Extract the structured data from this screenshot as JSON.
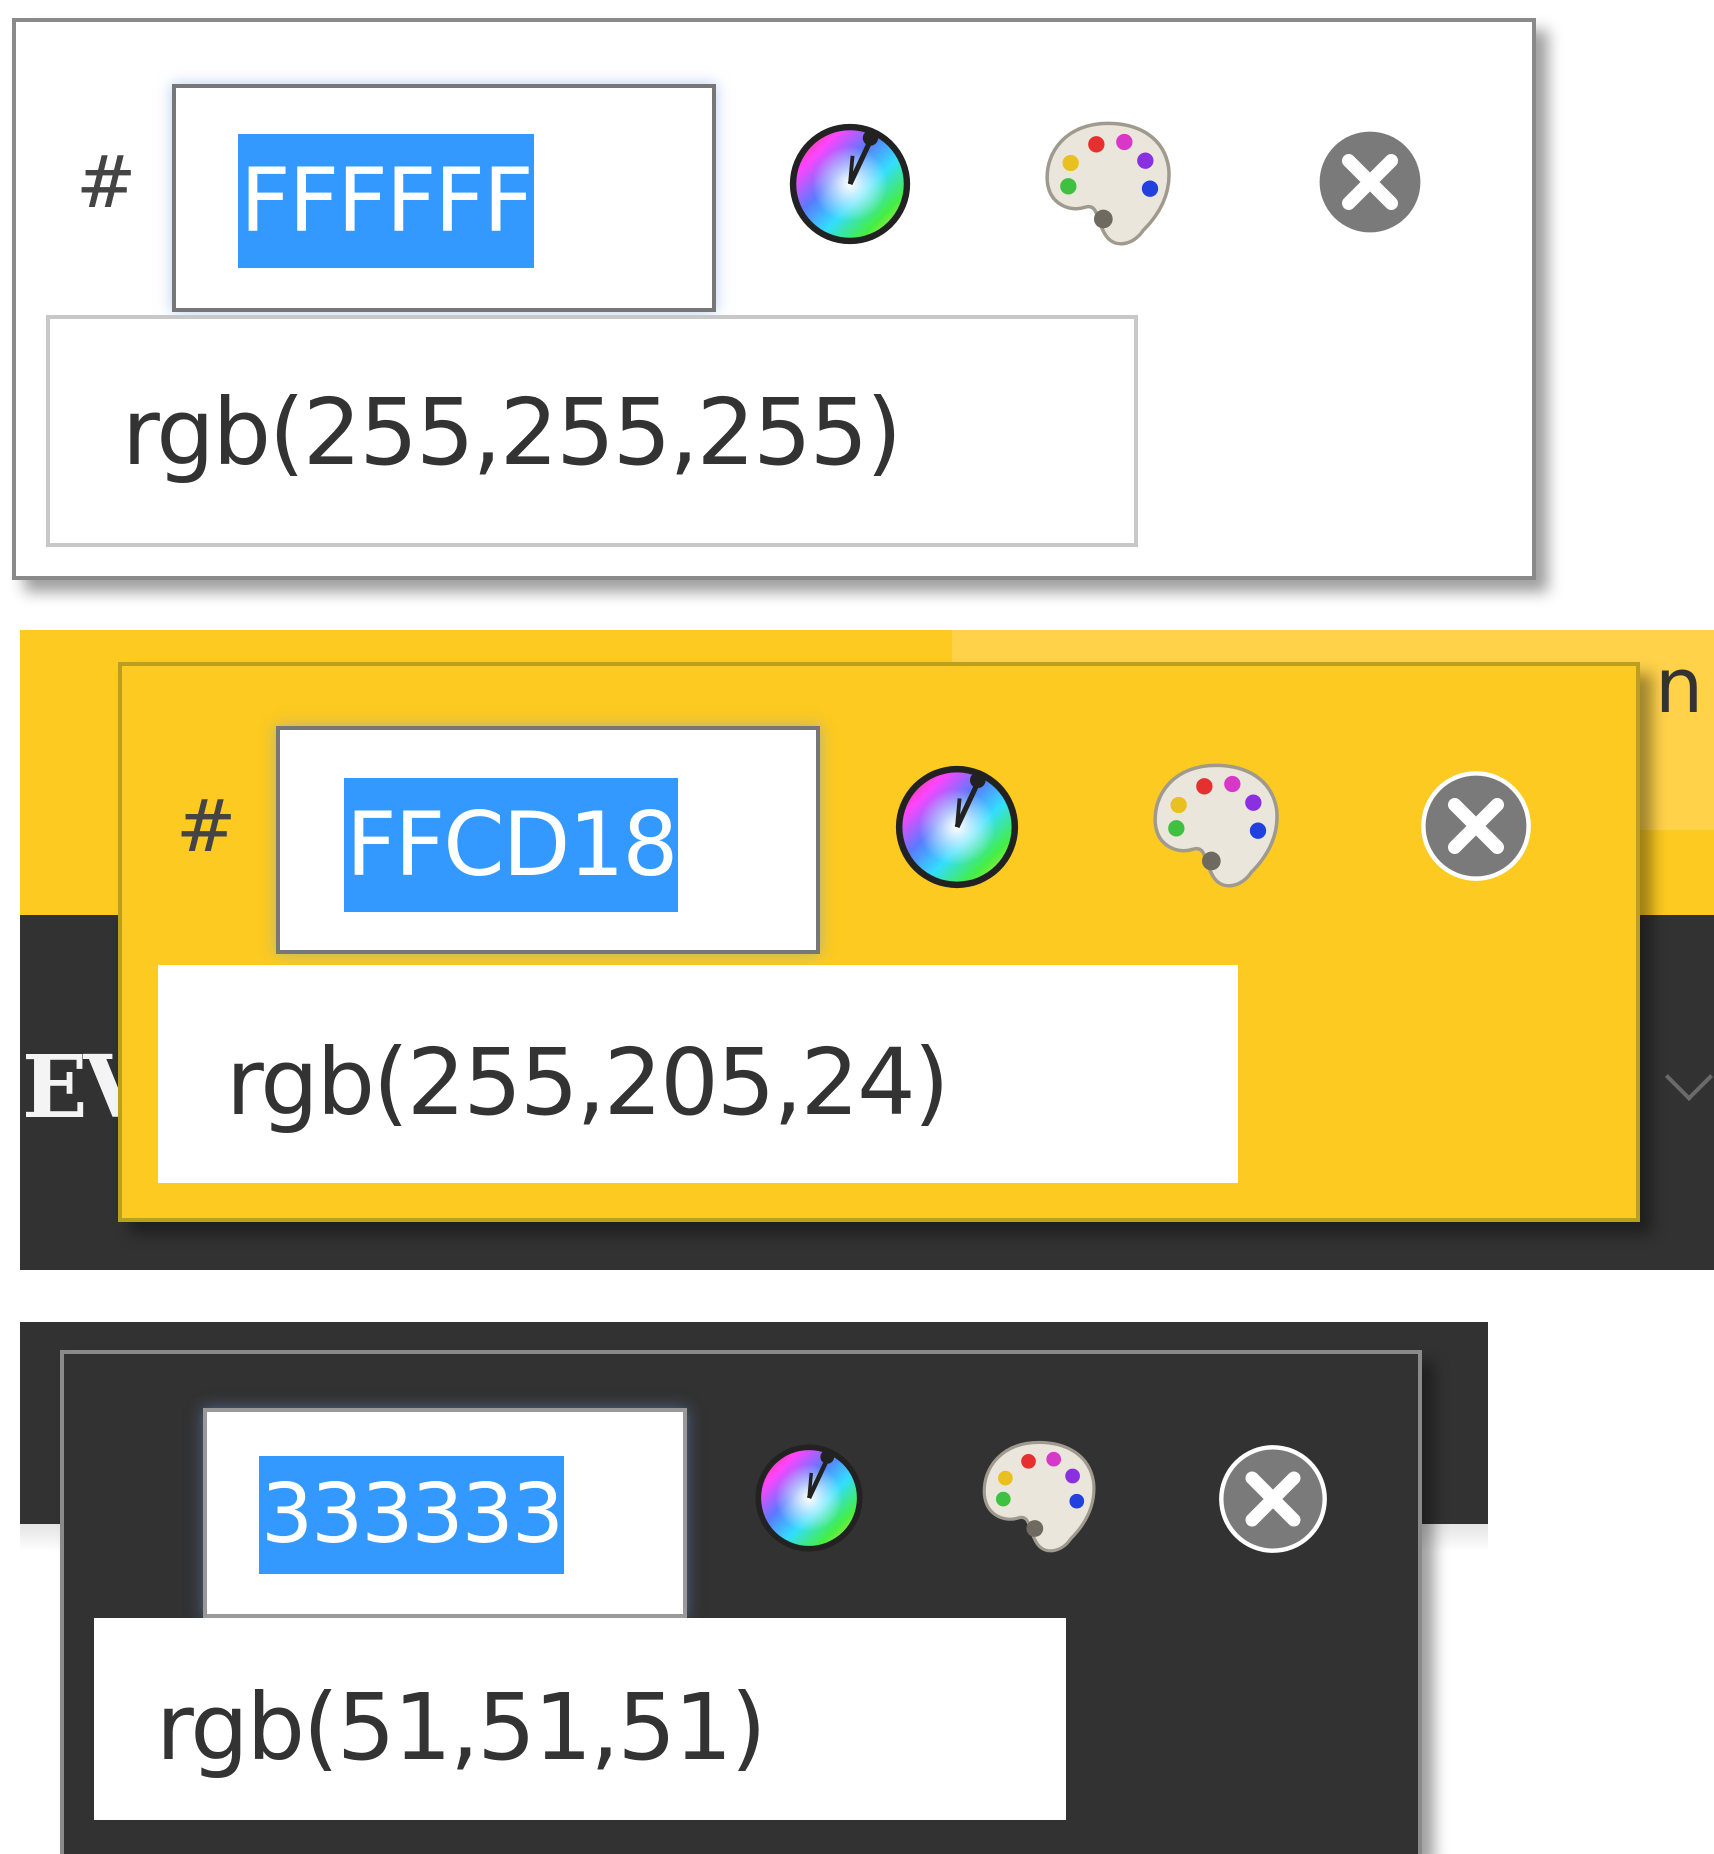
{
  "background": {
    "fragment_right": "n",
    "fragment_left": "EV"
  },
  "pickers": [
    {
      "hash": "#",
      "hex_value": "FFFFFF",
      "rgb_text": "rgb(255,255,255)",
      "panel_color": "#FFFFFF",
      "icons": [
        "color-wheel-icon",
        "palette-icon",
        "close-icon"
      ]
    },
    {
      "hash": "#",
      "hex_value": "FFCD18",
      "rgb_text": "rgb(255,205,24)",
      "panel_color": "#FFCD18",
      "icons": [
        "color-wheel-icon",
        "palette-icon",
        "close-icon"
      ]
    },
    {
      "hash": "",
      "hex_value": "333333",
      "rgb_text": "rgb(51,51,51)",
      "panel_color": "#333333",
      "icons": [
        "color-wheel-icon",
        "palette-icon",
        "close-icon"
      ]
    }
  ],
  "colors": {
    "selection_highlight": "#3399FF",
    "close_button": "#7A7A7A"
  }
}
